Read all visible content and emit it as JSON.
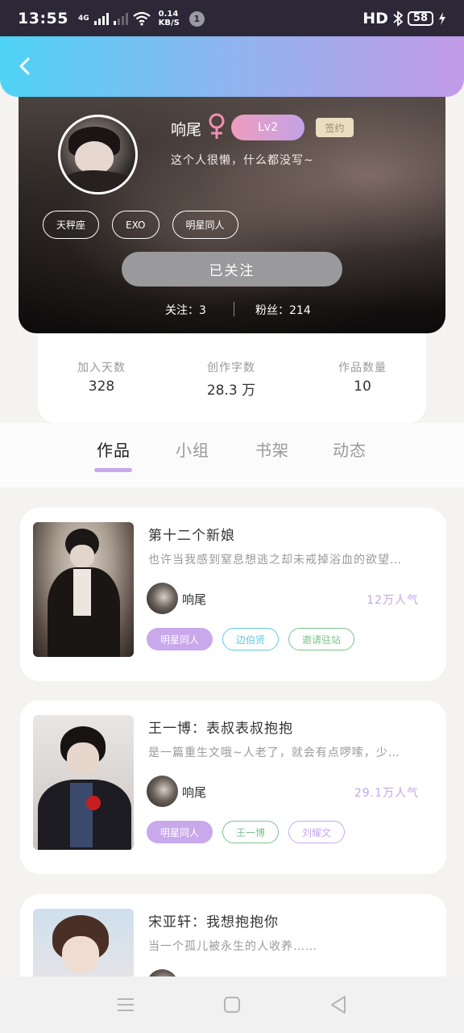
{
  "status_bar": {
    "time": "13:55",
    "network_type": "4G",
    "speed_value": "0.14",
    "speed_unit": "KB/S",
    "notification_count": "1",
    "hd_label": "HD",
    "battery": "58"
  },
  "profile": {
    "name": "响尾",
    "gender_symbol": "♀",
    "level": "Lv2",
    "sign_badge": "签约",
    "bio": "这个人很懒，什么都没写~",
    "tags": [
      "天秤座",
      "EXO",
      "明星同人"
    ],
    "follow_button": "已关注",
    "following_label": "关注：",
    "following_count": "3",
    "fans_label": "粉丝：",
    "fans_count": "214"
  },
  "stats": {
    "join_days_label": "加入天数",
    "join_days": "328",
    "word_count_label": "创作字数",
    "word_count": "28.3 万",
    "works_count_label": "作品数量",
    "works_count": "10"
  },
  "tabs": [
    {
      "label": "作品",
      "active": true
    },
    {
      "label": "小组",
      "active": false
    },
    {
      "label": "书架",
      "active": false
    },
    {
      "label": "动态",
      "active": false
    }
  ],
  "works": [
    {
      "title": "第十二个新娘",
      "summary": "也许当我感到窒息想逃之却未戒掉浴血的欲望…",
      "author": "响尾",
      "popularity": "12万人气",
      "tags": [
        {
          "label": "明星同人",
          "style": "filled-purple"
        },
        {
          "label": "边伯贤",
          "style": "outline-cyan"
        },
        {
          "label": "邀请驻站",
          "style": "outline-green"
        }
      ]
    },
    {
      "title": "王一博：表叔表叔抱抱",
      "summary": "是一篇重生文哦~人老了，就会有点啰嗦，少…",
      "author": "响尾",
      "popularity": "29.1万人气",
      "tags": [
        {
          "label": "明星同人",
          "style": "filled-purple"
        },
        {
          "label": "王一博",
          "style": "outline-green"
        },
        {
          "label": "刘耀文",
          "style": "outline-purple"
        }
      ]
    },
    {
      "title": "宋亚轩：我想抱抱你",
      "summary": "当一个孤儿被永生的人收养……",
      "author": "",
      "popularity": "",
      "tags": []
    }
  ],
  "colors": {
    "header_gradient_start": "#4ed3f4",
    "header_gradient_end": "#c29ae8",
    "accent_purple": "#c8a8ea",
    "level_gradient_start": "#ef9cbe",
    "level_gradient_end": "#c3a2e6"
  },
  "icons": {
    "back": "chevron-left-icon",
    "menu": "menu-icon",
    "home": "square-icon",
    "back_nav": "triangle-back-icon"
  }
}
